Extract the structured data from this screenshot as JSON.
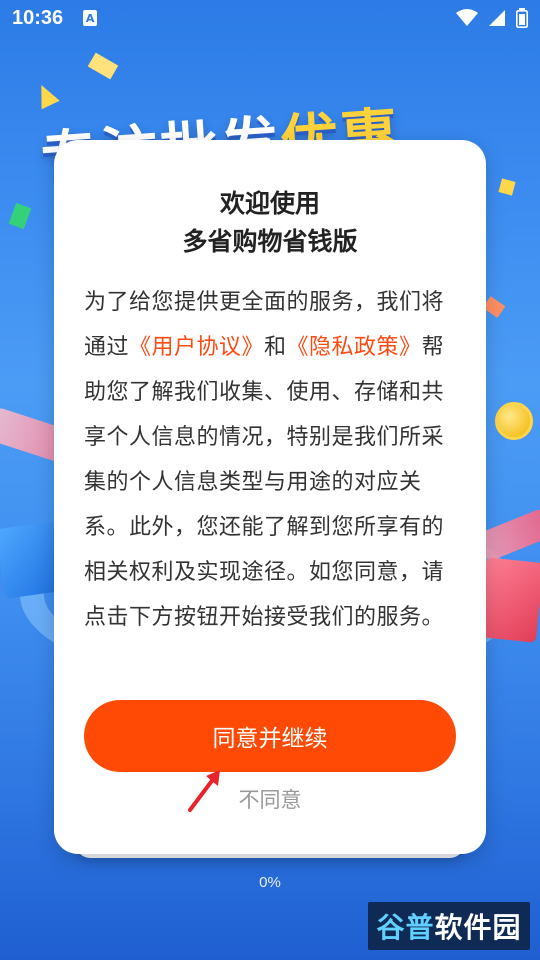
{
  "status_bar": {
    "time": "10:36",
    "notification_glyph": "A",
    "icons": [
      "wifi-icon",
      "signal-icon",
      "battery-icon"
    ]
  },
  "background": {
    "banner_text_part1": "专注批发",
    "banner_text_part2": "优惠"
  },
  "dialog": {
    "title_line1": "欢迎使用",
    "title_line2": "多省购物省钱版",
    "body_before_link1": "为了给您提供更全面的服务，我们将通过",
    "link_user_agreement": "《用户协议》",
    "body_and": "和",
    "link_privacy_policy": "《隐私政策》",
    "body_after_links": "帮助您了解我们收集、使用、存储和共享个人信息的情况，特别是我们所采集的个人信息类型与用途的对应关系。此外，您还能了解到您所享有的相关权利及实现途径。如您同意，请点击下方按钮开始接受我们的服务。",
    "agree_button_label": "同意并继续",
    "disagree_button_label": "不同意"
  },
  "progress": {
    "text": "0%",
    "value": 0
  },
  "watermark": {
    "part1": "谷普",
    "part2": "软件园"
  },
  "colors": {
    "accent": "#ff4a06",
    "link": "#ff4a12",
    "background": "#3a8af0"
  }
}
